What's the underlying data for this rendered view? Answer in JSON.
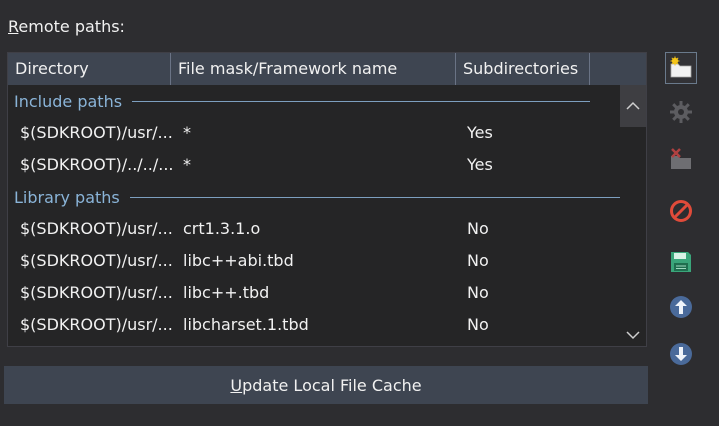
{
  "section": {
    "label_accel": "R",
    "label_rest": "emote paths:"
  },
  "table": {
    "columns": [
      "Directory",
      "File mask/Framework name",
      "Subdirectories"
    ],
    "groups": [
      {
        "label": "Include paths",
        "rows": [
          {
            "directory": "$(SDKROOT)/usr/...",
            "mask": "*",
            "subdirs": "Yes"
          },
          {
            "directory": "$(SDKROOT)/../../...",
            "mask": "*",
            "subdirs": "Yes"
          }
        ]
      },
      {
        "label": "Library paths",
        "rows": [
          {
            "directory": "$(SDKROOT)/usr/...",
            "mask": "crt1.3.1.o",
            "subdirs": "No"
          },
          {
            "directory": "$(SDKROOT)/usr/...",
            "mask": "libc++abi.tbd",
            "subdirs": "No"
          },
          {
            "directory": "$(SDKROOT)/usr/...",
            "mask": "libc++.tbd",
            "subdirs": "No"
          },
          {
            "directory": "$(SDKROOT)/usr/...",
            "mask": "libcharset.1.tbd",
            "subdirs": "No"
          }
        ]
      }
    ]
  },
  "update_button": {
    "accel": "U",
    "rest": "pdate Local File Cache"
  },
  "toolbar": [
    {
      "icon": "new-folder-icon",
      "enabled": true
    },
    {
      "icon": "gear-icon",
      "enabled": false
    },
    {
      "icon": "delete-icon",
      "enabled": false
    },
    {
      "icon": "cancel-icon",
      "enabled": true
    },
    {
      "icon": "save-icon",
      "enabled": true
    },
    {
      "icon": "move-up-icon",
      "enabled": true
    },
    {
      "icon": "move-down-icon",
      "enabled": true
    }
  ],
  "colors": {
    "background": "#2d2d30",
    "header": "#3e4551",
    "group_text": "#8ab4d8",
    "accent_blue": "#4a80c8",
    "stop_red": "#e04b3a",
    "save_green": "#3aa57a"
  }
}
